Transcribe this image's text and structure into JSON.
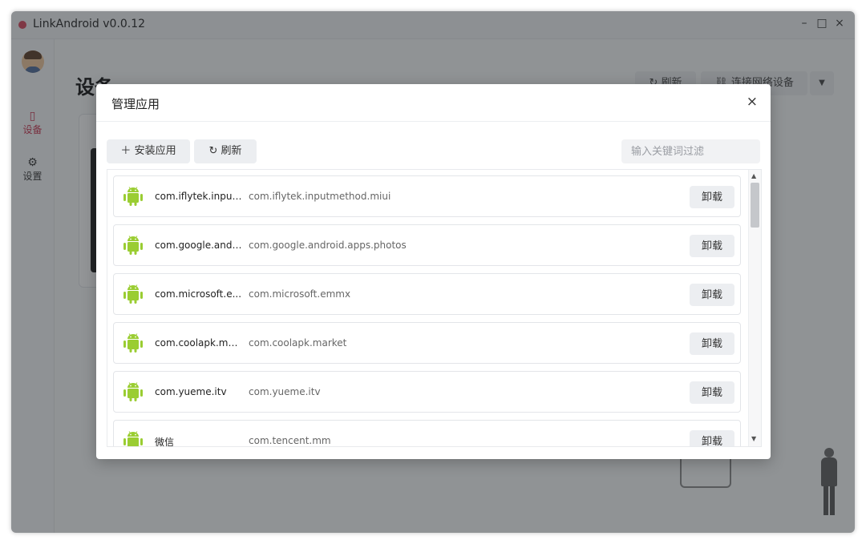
{
  "window": {
    "title": "LinkAndroid v0.0.12",
    "controls": {
      "minimize": "–",
      "maximize": "□",
      "close": "×"
    }
  },
  "sidebar": {
    "items": [
      {
        "label": "设备",
        "icon": "device-icon",
        "glyph": "▯",
        "active": true
      },
      {
        "label": "设置",
        "icon": "gear-icon",
        "glyph": "⚙",
        "active": false
      }
    ]
  },
  "page": {
    "title": "设备",
    "refresh_label": "刷新",
    "connect_label": "连接网络设备",
    "dropdown_glyph": "▼"
  },
  "modal": {
    "title": "管理应用",
    "close_glyph": "×",
    "install_label": "安装应用",
    "refresh_label": "刷新",
    "filter_placeholder": "输入关键词过滤",
    "uninstall_label": "卸载",
    "apps": [
      {
        "name": "com.iflytek.input...",
        "package": "com.iflytek.inputmethod.miui"
      },
      {
        "name": "com.google.andr...",
        "package": "com.google.android.apps.photos"
      },
      {
        "name": "com.microsoft.e...",
        "package": "com.microsoft.emmx"
      },
      {
        "name": "com.coolapk.mar...",
        "package": "com.coolapk.market"
      },
      {
        "name": "com.yueme.itv",
        "package": "com.yueme.itv"
      },
      {
        "name": "微信",
        "package": "com.tencent.mm"
      }
    ]
  },
  "colors": {
    "accent": "#c8334e",
    "android_green": "#9acd32"
  }
}
